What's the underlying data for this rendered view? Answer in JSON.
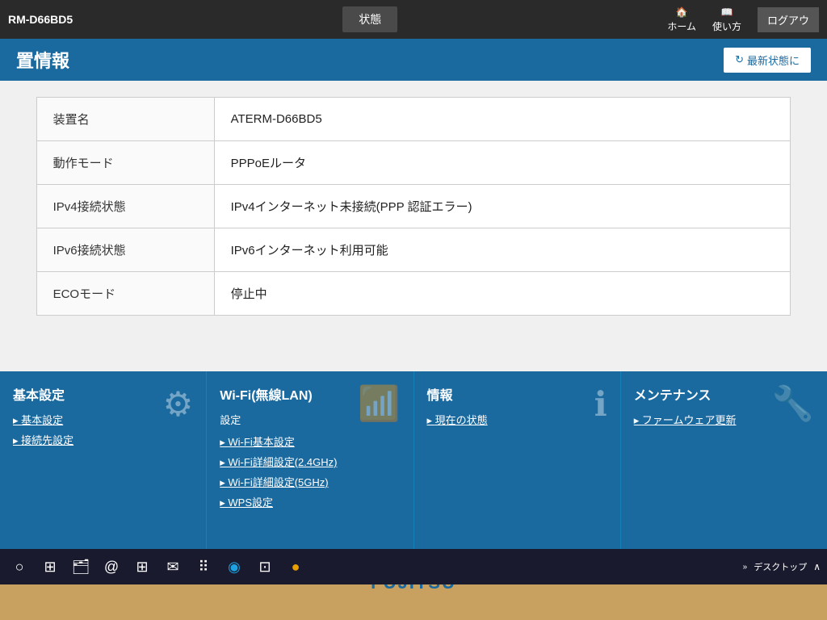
{
  "topNav": {
    "deviceId": "RM-D66BD5",
    "statusLabel": "状態",
    "homeLabel": "ホーム",
    "helpLabel": "使い方",
    "logoutLabel": "ログアウ"
  },
  "pageHeader": {
    "title": "置情報",
    "refreshLabel": "最新状態に"
  },
  "infoTable": {
    "rows": [
      {
        "label": "装置名",
        "value": "ATERM-D66BD5"
      },
      {
        "label": "動作モード",
        "value": "PPPoEルータ"
      },
      {
        "label": "IPv4接続状態",
        "value": "IPv4インターネット未接続(PPP 認証エラー)"
      },
      {
        "label": "IPv6接続状態",
        "value": "IPv6インターネット利用可能"
      },
      {
        "label": "ECOモード",
        "value": "停止中"
      }
    ]
  },
  "bottomMenu": {
    "sections": [
      {
        "id": "basic",
        "title": "基本設定",
        "icon": "⚙",
        "links": [
          "基本設定",
          "接続先設定"
        ]
      },
      {
        "id": "wifi",
        "title": "Wi-Fi(無線LAN)",
        "subtitle": "設定",
        "icon": "📶",
        "links": [
          "Wi-Fi基本設定",
          "Wi-Fi詳細設定(2.4GHz)",
          "Wi-Fi詳細設定(5GHz)",
          "WPS設定"
        ]
      },
      {
        "id": "info",
        "title": "情報",
        "icon": "ℹ",
        "links": [
          "現在の状態"
        ]
      },
      {
        "id": "maintenance",
        "title": "メンテナンス",
        "icon": "🔧",
        "links": [
          "ファームウェア更新"
        ]
      }
    ]
  },
  "taskbar": {
    "icons": [
      "○",
      "⊞",
      "🗂",
      "@",
      "🪟",
      "✉",
      "⠿",
      "◉",
      "⊡",
      "●"
    ],
    "desktopLabel": "デスクトップ",
    "arrowLabel": "∧"
  },
  "brandBar": {
    "logo": "FUJITSU"
  }
}
